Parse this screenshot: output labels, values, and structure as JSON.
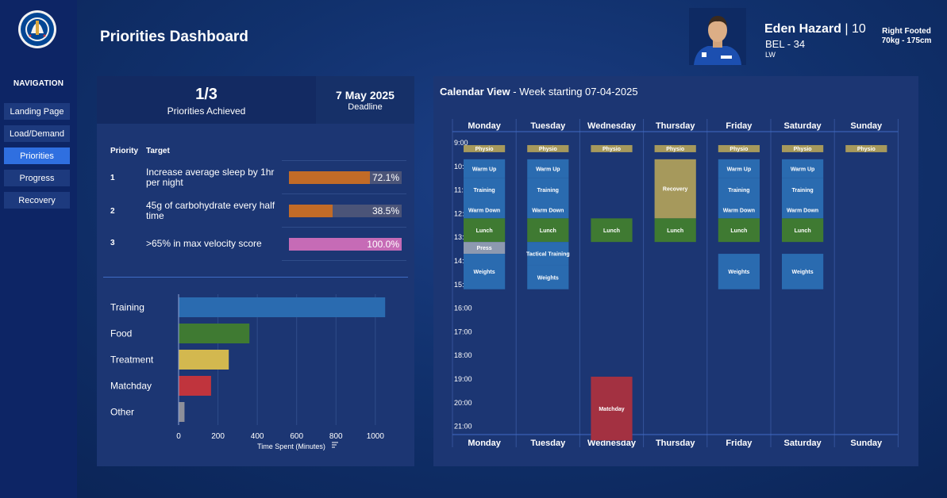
{
  "app": {
    "title": "Priorities Dashboard",
    "navigation_title": "NAVIGATION",
    "nav_items": [
      {
        "label": "Landing Page",
        "active": false
      },
      {
        "label": "Load/Demand",
        "active": false
      },
      {
        "label": "Priorities",
        "active": true
      },
      {
        "label": "Progress",
        "active": false
      },
      {
        "label": "Recovery",
        "active": false
      }
    ],
    "colors": {
      "accent": "#2f6fe0",
      "panel": "#1c3673",
      "sidebar": "#0d2565"
    }
  },
  "player": {
    "name": "Eden Hazard",
    "number": "| 10",
    "country_age": "BEL - 34",
    "position": "LW",
    "foot": "Right Footed",
    "size": "70kg - 175cm",
    "logo_icon": "chelsea-crest-icon",
    "photo_icon": "player-photo-icon"
  },
  "priorities": {
    "achieved_value": "1/3",
    "achieved_label": "Priorities Achieved",
    "deadline_value": "7 May 2025",
    "deadline_label": "Deadline",
    "header_priority": "Priority",
    "header_target": "Target",
    "rows": [
      {
        "num": "1",
        "target": "Increase average sleep by 1hr per night",
        "percent": 72.1,
        "percent_text": "72.1%",
        "color": "#c26b27"
      },
      {
        "num": "2",
        "target": "45g of carbohydrate every half time",
        "percent": 38.5,
        "percent_text": "38.5%",
        "color": "#c26b27"
      },
      {
        "num": "3",
        "target": ">65% in max velocity score",
        "percent": 100.0,
        "percent_text": "100.0%",
        "color": "#c66bb6"
      }
    ]
  },
  "chart_data": {
    "type": "bar",
    "orientation": "horizontal",
    "categories": [
      "Training",
      "Food",
      "Treatment",
      "Matchday",
      "Other"
    ],
    "values": [
      1050,
      360,
      255,
      165,
      30
    ],
    "colors": [
      "#2a6bb0",
      "#3f7a32",
      "#d3b84f",
      "#c0343d",
      "#8d8f9a"
    ],
    "xlabel": "Time Spent (Minutes)",
    "xticks": [
      0,
      200,
      400,
      600,
      800,
      1000
    ],
    "xlim": [
      0,
      1150
    ],
    "grid": true,
    "legend": "none"
  },
  "calendar": {
    "title": "Calendar View",
    "subtitle": "- Week starting 07-04-2025",
    "days": [
      "Monday",
      "Tuesday",
      "Wednesday",
      "Thursday",
      "Friday",
      "Saturday",
      "Sunday"
    ],
    "hours": [
      "9:00",
      "10:00",
      "11:00",
      "12:00",
      "13:00",
      "14:00",
      "15:00",
      "16:00",
      "17:00",
      "18:00",
      "19:00",
      "20:00",
      "21:00"
    ],
    "colors": {
      "physio": "#a6995c",
      "session": "#2a6bb0",
      "lunch": "#3f7a32",
      "recovery": "#a6995c",
      "press": "#8d99b0",
      "matchday": "#a33141"
    },
    "events": [
      {
        "day": 0,
        "start": 9.1,
        "end": 9.4,
        "label": "Physio",
        "kind": "physio"
      },
      {
        "day": 0,
        "start": 9.7,
        "end": 10.5,
        "label": "Warm Up",
        "kind": "session"
      },
      {
        "day": 0,
        "start": 10.5,
        "end": 11.5,
        "label": "Training",
        "kind": "session"
      },
      {
        "day": 0,
        "start": 11.5,
        "end": 12.2,
        "label": "Warm Down",
        "kind": "session"
      },
      {
        "day": 0,
        "start": 12.2,
        "end": 13.2,
        "label": "Lunch",
        "kind": "lunch"
      },
      {
        "day": 0,
        "start": 13.2,
        "end": 13.7,
        "label": "Press",
        "kind": "press"
      },
      {
        "day": 0,
        "start": 13.7,
        "end": 15.2,
        "label": "Weights",
        "kind": "session"
      },
      {
        "day": 1,
        "start": 9.1,
        "end": 9.4,
        "label": "Physio",
        "kind": "physio"
      },
      {
        "day": 1,
        "start": 9.7,
        "end": 10.5,
        "label": "Warm Up",
        "kind": "session"
      },
      {
        "day": 1,
        "start": 10.5,
        "end": 11.5,
        "label": "Training",
        "kind": "session"
      },
      {
        "day": 1,
        "start": 11.5,
        "end": 12.2,
        "label": "Warm Down",
        "kind": "session"
      },
      {
        "day": 1,
        "start": 12.2,
        "end": 13.2,
        "label": "Lunch",
        "kind": "lunch"
      },
      {
        "day": 1,
        "start": 13.2,
        "end": 14.2,
        "label": "Tactical Training",
        "kind": "session"
      },
      {
        "day": 1,
        "start": 14.2,
        "end": 15.2,
        "label": "Weights",
        "kind": "session"
      },
      {
        "day": 2,
        "start": 9.1,
        "end": 9.4,
        "label": "Physio",
        "kind": "physio"
      },
      {
        "day": 2,
        "start": 12.2,
        "end": 13.2,
        "label": "Lunch",
        "kind": "lunch"
      },
      {
        "day": 2,
        "start": 18.9,
        "end": 21.6,
        "label": "Matchday",
        "kind": "matchday"
      },
      {
        "day": 3,
        "start": 9.1,
        "end": 9.4,
        "label": "Physio",
        "kind": "physio"
      },
      {
        "day": 3,
        "start": 9.7,
        "end": 12.2,
        "label": "Recovery",
        "kind": "recovery"
      },
      {
        "day": 3,
        "start": 12.2,
        "end": 13.2,
        "label": "Lunch",
        "kind": "lunch"
      },
      {
        "day": 4,
        "start": 9.1,
        "end": 9.4,
        "label": "Physio",
        "kind": "physio"
      },
      {
        "day": 4,
        "start": 9.7,
        "end": 10.5,
        "label": "Warm Up",
        "kind": "session"
      },
      {
        "day": 4,
        "start": 10.5,
        "end": 11.5,
        "label": "Training",
        "kind": "session"
      },
      {
        "day": 4,
        "start": 11.5,
        "end": 12.2,
        "label": "Warm Down",
        "kind": "session"
      },
      {
        "day": 4,
        "start": 12.2,
        "end": 13.2,
        "label": "Lunch",
        "kind": "lunch"
      },
      {
        "day": 4,
        "start": 13.7,
        "end": 15.2,
        "label": "Weights",
        "kind": "session"
      },
      {
        "day": 5,
        "start": 9.1,
        "end": 9.4,
        "label": "Physio",
        "kind": "physio"
      },
      {
        "day": 5,
        "start": 9.7,
        "end": 10.5,
        "label": "Warm Up",
        "kind": "session"
      },
      {
        "day": 5,
        "start": 10.5,
        "end": 11.5,
        "label": "Training",
        "kind": "session"
      },
      {
        "day": 5,
        "start": 11.5,
        "end": 12.2,
        "label": "Warm Down",
        "kind": "session"
      },
      {
        "day": 5,
        "start": 12.2,
        "end": 13.2,
        "label": "Lunch",
        "kind": "lunch"
      },
      {
        "day": 5,
        "start": 13.7,
        "end": 15.2,
        "label": "Weights",
        "kind": "session"
      },
      {
        "day": 6,
        "start": 9.1,
        "end": 9.4,
        "label": "Physio",
        "kind": "physio"
      }
    ]
  }
}
